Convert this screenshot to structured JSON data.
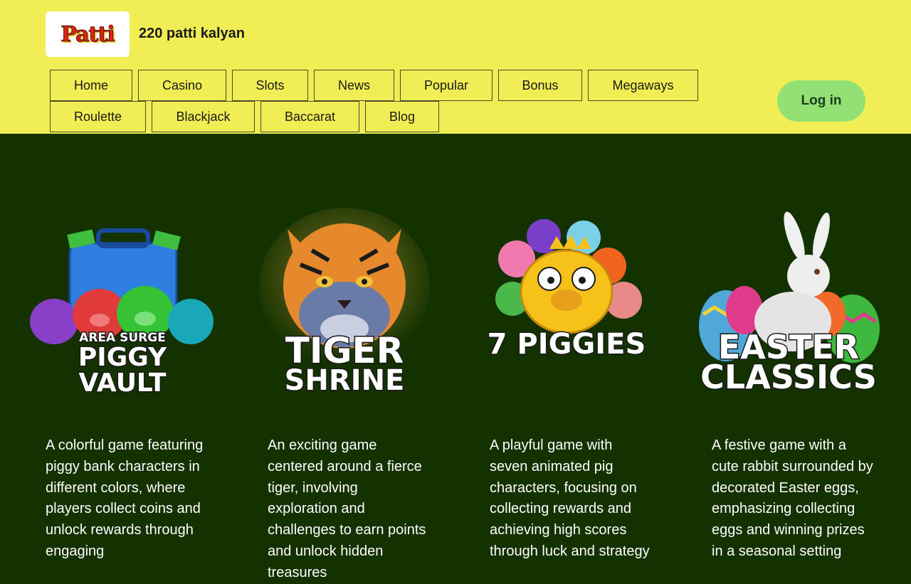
{
  "header": {
    "logo_text": "Patti",
    "site_name": "220 patti kalyan",
    "login_label": "Log in"
  },
  "nav": {
    "items": [
      "Home",
      "Casino",
      "Slots",
      "News",
      "Popular",
      "Bonus",
      "Megaways",
      "Roulette",
      "Blackjack",
      "Baccarat",
      "Blog"
    ]
  },
  "games": [
    {
      "title_small": "AREA SURGE",
      "title_line1": "PIGGY",
      "title_line2": "VAULT",
      "description": "A colorful game featuring piggy bank characters in different colors, where players collect coins and unlock rewards through engaging"
    },
    {
      "title_line1": "TIGER",
      "title_line2": "SHRINE",
      "description": "An exciting game centered around a fierce tiger, involving exploration and challenges to earn points and unlock hidden treasures"
    },
    {
      "title_line1": "7 PIGGIES",
      "description": "A playful game with seven animated pig characters, focusing on collecting rewards and achieving high scores through luck and strategy"
    },
    {
      "title_line1": "EASTER",
      "title_line2": "CLASSICS",
      "description": "A festive game with a cute rabbit surrounded by decorated Easter eggs, emphasizing collecting eggs and winning prizes in a seasonal setting"
    }
  ],
  "colors": {
    "header_bg": "#f0ee54",
    "page_bg": "#133200",
    "login_bg": "#93e175"
  }
}
